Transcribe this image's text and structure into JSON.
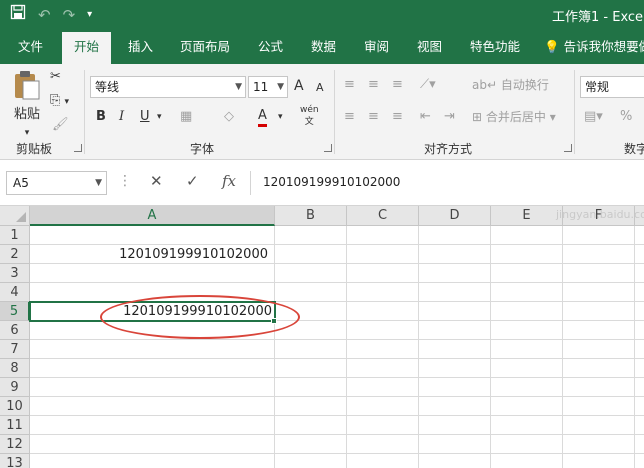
{
  "app": {
    "title": "工作簿1 - Excel",
    "accent": "#217346"
  },
  "qat": {
    "save_icon": "save-icon",
    "undo_icon": "undo-icon",
    "redo_icon": "redo-icon",
    "customize_icon": "chevron-down-icon"
  },
  "tabs": [
    {
      "label": "文件"
    },
    {
      "label": "开始",
      "active": true
    },
    {
      "label": "插入"
    },
    {
      "label": "页面布局"
    },
    {
      "label": "公式"
    },
    {
      "label": "数据"
    },
    {
      "label": "审阅"
    },
    {
      "label": "视图"
    },
    {
      "label": "特色功能"
    }
  ],
  "tellme": "告诉我你想要做",
  "ribbon": {
    "clipboard": {
      "label": "剪贴板",
      "paste": "粘贴"
    },
    "font": {
      "label": "字体",
      "font_name": "等线",
      "font_size": "11",
      "grow": "A",
      "shrink": "A",
      "bold": "B",
      "italic": "I",
      "underline": "U",
      "font_color": "A",
      "phonetic": "wén",
      "font_color_hex": "#d40000"
    },
    "alignment": {
      "label": "对齐方式",
      "wrap_text": "自动换行",
      "merge_center": "合并后居中"
    },
    "number": {
      "label": "数字",
      "format": "常规",
      "percent": "%"
    }
  },
  "formula_bar": {
    "name_box": "A5",
    "cancel": "✕",
    "confirm": "✓",
    "fx": "fx",
    "value": "120109199910102000"
  },
  "grid": {
    "columns": [
      "A",
      "B",
      "C",
      "D",
      "E",
      "F"
    ],
    "selected_column": "A",
    "rows": [
      "1",
      "2",
      "3",
      "4",
      "5",
      "6",
      "7",
      "8",
      "9",
      "10",
      "11",
      "12",
      "13"
    ],
    "selected_row": "5",
    "cells": {
      "A2": "120109199910102000",
      "A5": "120109199910102000"
    },
    "active_cell": "A5",
    "annotation_color": "#d9453a"
  },
  "watermark": "jingyan.baidu.com"
}
